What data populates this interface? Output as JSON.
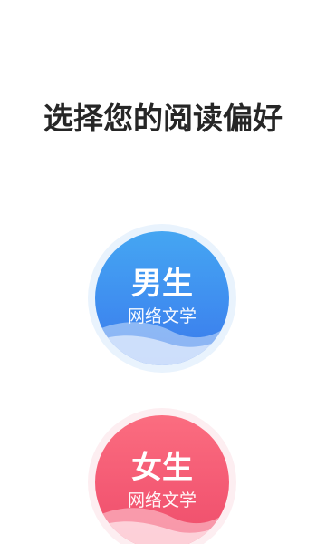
{
  "page": {
    "title": "选择您的阅读偏好"
  },
  "options": {
    "male": {
      "label": "男生",
      "sub": "网络文学",
      "color": "#3f8ef0"
    },
    "female": {
      "label": "女生",
      "sub": "网络文学",
      "color": "#f45a74"
    }
  }
}
